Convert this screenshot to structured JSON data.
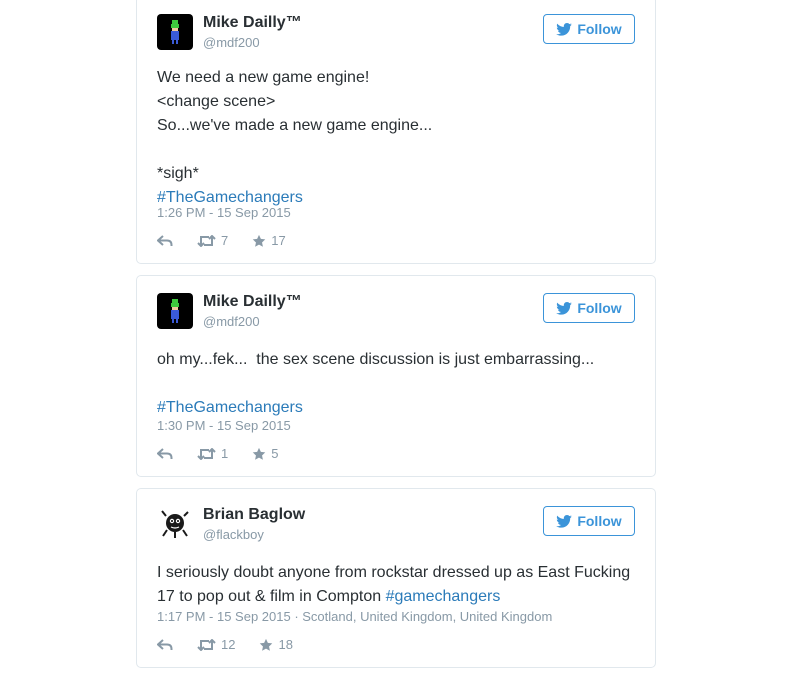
{
  "colors": {
    "link": "#2b7bb9",
    "follow": "#3b94d9",
    "muted": "#8899a6",
    "text": "#292f33",
    "border": "#e1e8ed"
  },
  "follow_label": "Follow",
  "tweets": [
    {
      "name": "Mike Dailly™",
      "handle": "@mdf200",
      "lines": [
        "We need a new game engine!",
        "<change scene>",
        "So...we've made a new game engine...",
        "",
        "*sigh*"
      ],
      "hashtag": "#TheGamechangers",
      "meta": "1:26 PM - 15 Sep 2015",
      "retweets": "7",
      "likes": "17"
    },
    {
      "name": "Mike Dailly™",
      "handle": "@mdf200",
      "lines": [
        "oh my...fek...  the sex scene discussion is just embarrassing...",
        ""
      ],
      "hashtag": "#TheGamechangers",
      "meta": "1:30 PM - 15 Sep 2015",
      "retweets": "1",
      "likes": "5"
    },
    {
      "name": "Brian Baglow",
      "handle": "@flackboy",
      "line1": "I seriously doubt anyone from rockstar dressed up as East Fucking",
      "line2": "17 to pop out & film in Compton ",
      "hashtag": "#gamechangers",
      "meta": "1:17 PM - 15 Sep 2015 · Scotland, United Kingdom, United Kingdom",
      "retweets": "12",
      "likes": "18"
    }
  ]
}
